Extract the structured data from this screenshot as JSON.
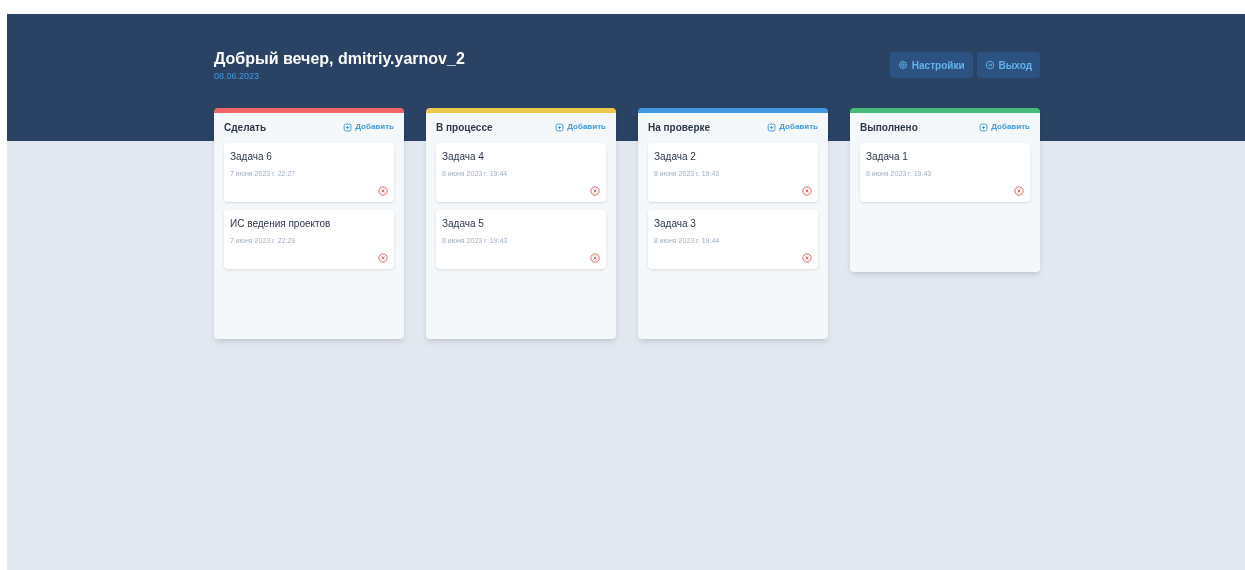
{
  "header": {
    "greeting": "Добрый вечер, dmitriy.yarnov_2",
    "date": "08.06.2023",
    "buttons": [
      {
        "label": "Настройки",
        "kind": "settings"
      },
      {
        "label": "Выход",
        "kind": "logout"
      }
    ]
  },
  "columns": [
    {
      "title": "Сделать",
      "color": "#f06565",
      "add_label": "Добавить",
      "tasks": [
        {
          "title": "Задача 6",
          "date": "7 июня 2023 г. 22:27"
        },
        {
          "title": "ИС ведения проектов",
          "date": "7 июня 2023 г. 22:29"
        }
      ]
    },
    {
      "title": "В процессе",
      "color": "#ecc94b",
      "add_label": "Добавить",
      "tasks": [
        {
          "title": "Задача 4",
          "date": "8 июня 2023 г. 19:44"
        },
        {
          "title": "Задача 5",
          "date": "8 июня 2023 г. 19:43"
        }
      ]
    },
    {
      "title": "На проверке",
      "color": "#4299e1",
      "add_label": "Добавить",
      "tasks": [
        {
          "title": "Задача 2",
          "date": "8 июня 2023 г. 19:43"
        },
        {
          "title": "Задача 3",
          "date": "8 июня 2023 г. 19:44"
        }
      ]
    },
    {
      "title": "Выполнено",
      "color": "#48bb78",
      "add_label": "Добавить",
      "tasks": [
        {
          "title": "Задача 1",
          "date": "8 июня 2023 г. 19:43"
        }
      ]
    }
  ]
}
